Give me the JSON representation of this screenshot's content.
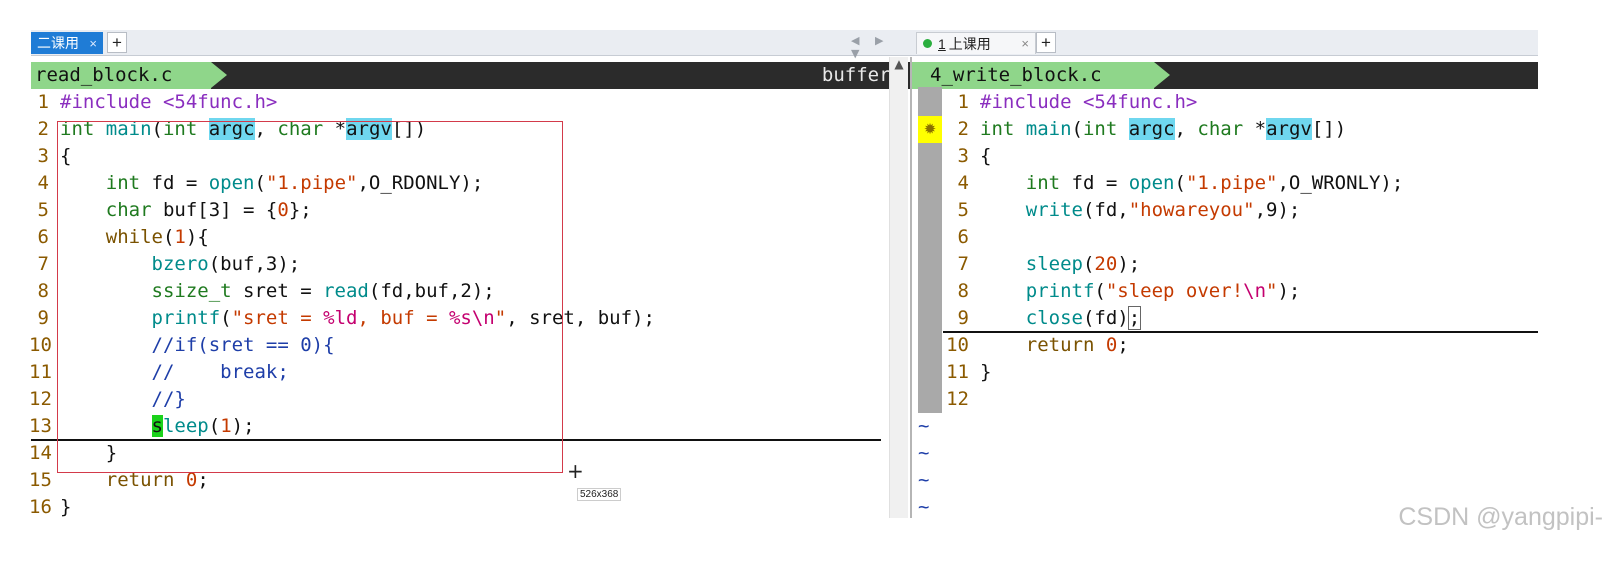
{
  "left": {
    "tab_label": "二课用",
    "tab_close": "×",
    "plus": "+",
    "nav_arrows": "◀ ▶ ▼",
    "filename": "read_block.c",
    "buffers": "buffers"
  },
  "right": {
    "tab_num": "1",
    "tab_label": "上课用",
    "tab_close": "×",
    "plus": "+",
    "filename": "4_write_block.c",
    "sign": "✹"
  },
  "selection_tooltip": "526x368",
  "crosshair": "+",
  "watermark": "CSDN @yangpipi-",
  "tilde": "~",
  "left_code": [
    {
      "n": "1",
      "tokens": [
        [
          "c-pre",
          "#include <54func.h>"
        ]
      ]
    },
    {
      "n": "2",
      "tokens": [
        [
          "c-type",
          "int"
        ],
        [
          "",
          ""
        ],
        [
          "c-func",
          " main"
        ],
        [
          "",
          "("
        ],
        [
          "c-type",
          "int"
        ],
        [
          "",
          " "
        ],
        [
          "hl",
          "argc"
        ],
        [
          "",
          ", "
        ],
        [
          "c-type",
          "char"
        ],
        [
          "",
          " *"
        ],
        [
          "hl",
          "argv"
        ],
        [
          "",
          "[])"
        ]
      ]
    },
    {
      "n": "3",
      "tokens": [
        [
          "",
          "{"
        ]
      ]
    },
    {
      "n": "4",
      "tokens": [
        [
          "",
          "    "
        ],
        [
          "c-type",
          "int"
        ],
        [
          "",
          " fd = "
        ],
        [
          "c-func",
          "open"
        ],
        [
          "",
          "("
        ],
        [
          "c-str",
          "\"1.pipe\""
        ],
        [
          "",
          ",O_RDONLY);"
        ]
      ]
    },
    {
      "n": "5",
      "tokens": [
        [
          "",
          "    "
        ],
        [
          "c-type",
          "char"
        ],
        [
          "",
          " buf[3] = {"
        ],
        [
          "c-num",
          "0"
        ],
        [
          "",
          "};"
        ]
      ]
    },
    {
      "n": "6",
      "tokens": [
        [
          "",
          "    "
        ],
        [
          "c-kw",
          "while"
        ],
        [
          "",
          "("
        ],
        [
          "c-num",
          "1"
        ],
        [
          "",
          "){"
        ]
      ]
    },
    {
      "n": "7",
      "tokens": [
        [
          "",
          "        "
        ],
        [
          "c-func",
          "bzero"
        ],
        [
          "",
          "(buf,3);"
        ]
      ]
    },
    {
      "n": "8",
      "tokens": [
        [
          "",
          "        "
        ],
        [
          "c-type",
          "ssize_t"
        ],
        [
          "",
          " sret = "
        ],
        [
          "c-func",
          "read"
        ],
        [
          "",
          "(fd,buf,2);"
        ]
      ]
    },
    {
      "n": "9",
      "tokens": [
        [
          "",
          "        "
        ],
        [
          "c-func",
          "printf"
        ],
        [
          "",
          "("
        ],
        [
          "c-str",
          "\"sret = "
        ],
        [
          "c-fmt",
          "%ld"
        ],
        [
          "c-str",
          ", buf = "
        ],
        [
          "c-fmt",
          "%s\\n"
        ],
        [
          "c-str",
          "\""
        ],
        [
          "",
          ", sret, buf);"
        ]
      ]
    },
    {
      "n": "10",
      "tokens": [
        [
          "",
          "        "
        ],
        [
          "c-cm",
          "//if(sret == 0){"
        ]
      ]
    },
    {
      "n": "11",
      "tokens": [
        [
          "",
          "        "
        ],
        [
          "c-cm",
          "//    break;"
        ]
      ]
    },
    {
      "n": "12",
      "tokens": [
        [
          "",
          "        "
        ],
        [
          "c-cm",
          "//}"
        ]
      ]
    },
    {
      "n": "13",
      "tokens": [
        [
          "",
          "        "
        ],
        [
          "cursor-box",
          "s"
        ],
        [
          "c-func",
          "leep"
        ],
        [
          "",
          "("
        ],
        [
          "c-num",
          "1"
        ],
        [
          "",
          ");"
        ]
      ]
    },
    {
      "n": "14",
      "tokens": [
        [
          "",
          "    }"
        ]
      ]
    },
    {
      "n": "15",
      "tokens": [
        [
          "",
          "    "
        ],
        [
          "c-kw",
          "return"
        ],
        [
          "",
          " "
        ],
        [
          "c-num",
          "0"
        ],
        [
          "",
          ";"
        ]
      ]
    },
    {
      "n": "16",
      "tokens": [
        [
          "",
          "}"
        ]
      ]
    }
  ],
  "right_code": [
    {
      "n": "1",
      "tokens": [
        [
          "c-pre",
          "#include <54func.h>"
        ]
      ]
    },
    {
      "n": "2",
      "tokens": [
        [
          "c-type",
          "int"
        ],
        [
          "c-func",
          " main"
        ],
        [
          "",
          "("
        ],
        [
          "c-type",
          "int"
        ],
        [
          "",
          " "
        ],
        [
          "hl",
          "argc"
        ],
        [
          "",
          ", "
        ],
        [
          "c-type",
          "char"
        ],
        [
          "",
          " *"
        ],
        [
          "hl",
          "argv"
        ],
        [
          "",
          "[])"
        ]
      ]
    },
    {
      "n": "3",
      "tokens": [
        [
          "",
          "{"
        ]
      ]
    },
    {
      "n": "4",
      "tokens": [
        [
          "",
          "    "
        ],
        [
          "c-type",
          "int"
        ],
        [
          "",
          " fd = "
        ],
        [
          "c-func",
          "open"
        ],
        [
          "",
          "("
        ],
        [
          "c-str",
          "\"1.pipe\""
        ],
        [
          "",
          ",O_WRONLY);"
        ]
      ]
    },
    {
      "n": "5",
      "tokens": [
        [
          "",
          "    "
        ],
        [
          "c-func",
          "write"
        ],
        [
          "",
          "(fd,"
        ],
        [
          "c-str",
          "\"howareyou\""
        ],
        [
          "",
          ",9);"
        ]
      ]
    },
    {
      "n": "6",
      "tokens": []
    },
    {
      "n": "7",
      "tokens": [
        [
          "",
          "    "
        ],
        [
          "c-func",
          "sleep"
        ],
        [
          "",
          "("
        ],
        [
          "c-num",
          "20"
        ],
        [
          "",
          ");"
        ]
      ]
    },
    {
      "n": "8",
      "tokens": [
        [
          "",
          "    "
        ],
        [
          "c-func",
          "printf"
        ],
        [
          "",
          "("
        ],
        [
          "c-str",
          "\"sleep over!"
        ],
        [
          "c-fmt",
          "\\n"
        ],
        [
          "c-str",
          "\""
        ],
        [
          "",
          ");"
        ]
      ]
    },
    {
      "n": "9",
      "tokens": [
        [
          "",
          "    "
        ],
        [
          "c-func",
          "close"
        ],
        [
          "",
          "(fd)"
        ],
        [
          "sq",
          ";"
        ]
      ]
    },
    {
      "n": "10",
      "tokens": [
        [
          "",
          "    "
        ],
        [
          "c-kw",
          "return"
        ],
        [
          "",
          " "
        ],
        [
          "c-num",
          "0"
        ],
        [
          "",
          ";"
        ]
      ]
    },
    {
      "n": "11",
      "tokens": [
        [
          "",
          "}"
        ]
      ]
    },
    {
      "n": "12",
      "tokens": []
    }
  ]
}
